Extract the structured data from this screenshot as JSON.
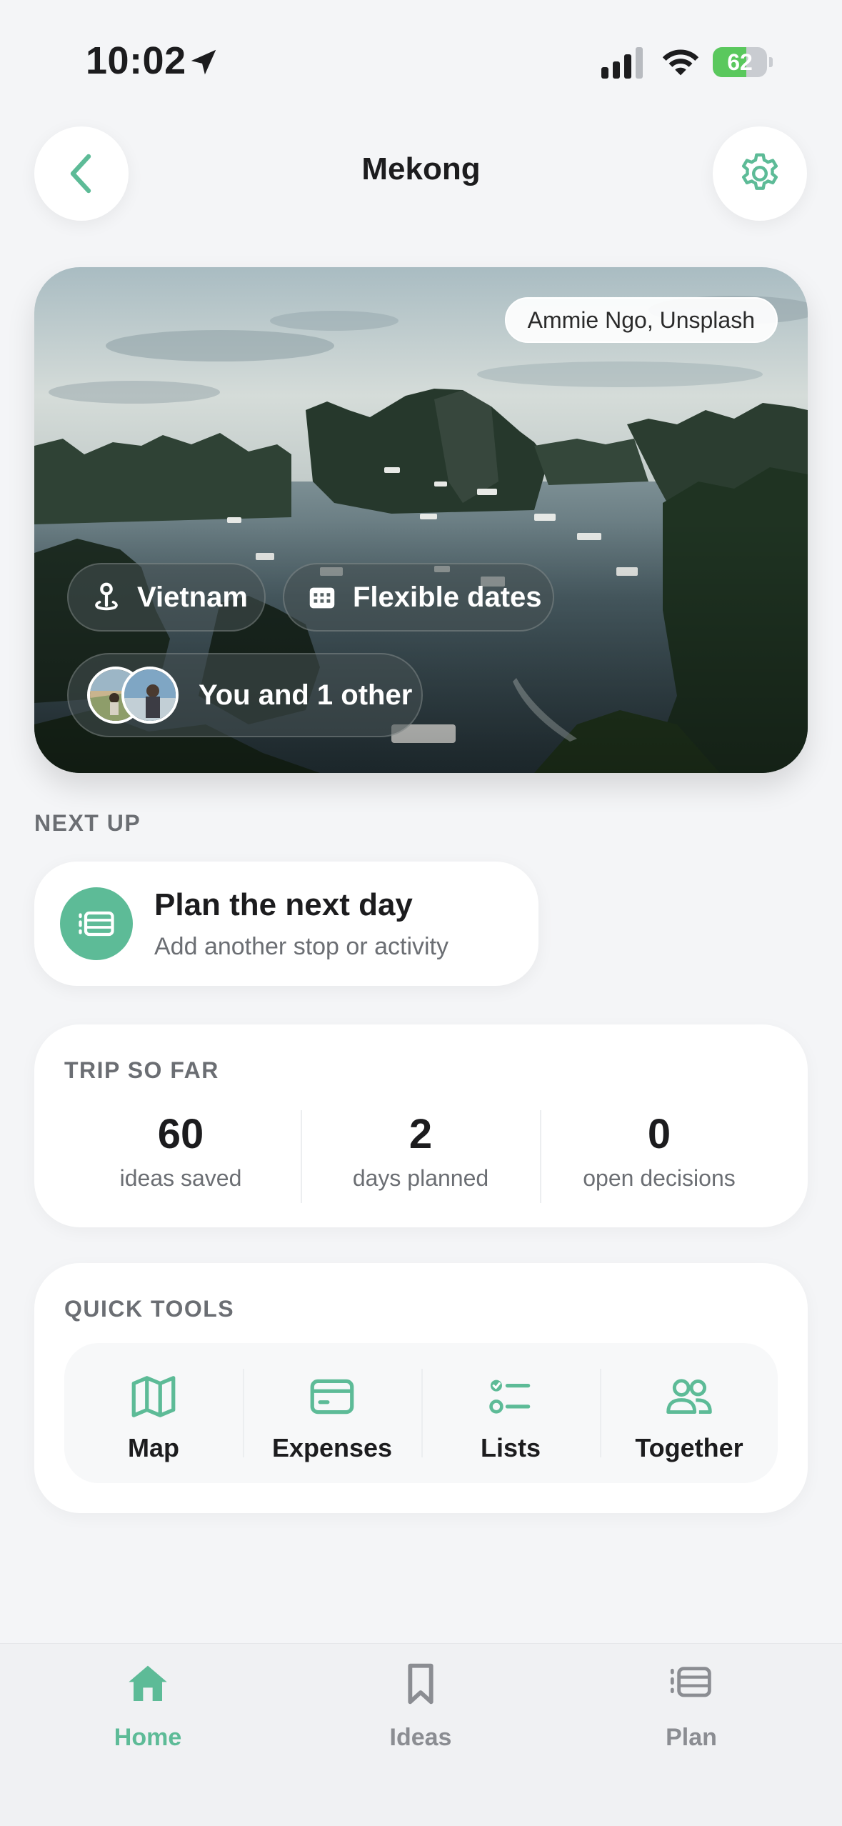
{
  "status_bar": {
    "time": "10:02",
    "battery_percent": "62",
    "battery_level": 0.62,
    "icons": [
      "location-arrow-icon",
      "cellular-signal-icon",
      "wifi-icon",
      "battery-charging-icon"
    ]
  },
  "header": {
    "title": "Mekong",
    "back_icon": "chevron-left-icon",
    "settings_icon": "gear-icon"
  },
  "hero": {
    "photo_credit": "Ammie Ngo, Unsplash",
    "location": "Vietnam",
    "dates": "Flexible dates",
    "people": "You and 1 other",
    "location_icon": "map-pin-icon",
    "dates_icon": "calendar-icon"
  },
  "next_up": {
    "label": "NEXT UP",
    "title": "Plan the next day",
    "subtitle": "Add another stop or activity",
    "icon": "itinerary-icon"
  },
  "trip_so_far": {
    "label": "TRIP SO FAR",
    "stats": [
      {
        "value": "60",
        "caption": "ideas saved"
      },
      {
        "value": "2",
        "caption": "days planned"
      },
      {
        "value": "0",
        "caption": "open decisions"
      }
    ]
  },
  "quick_tools": {
    "label": "QUICK TOOLS",
    "tools": [
      {
        "label": "Map",
        "icon": "map-icon"
      },
      {
        "label": "Expenses",
        "icon": "credit-card-icon"
      },
      {
        "label": "Lists",
        "icon": "checklist-icon"
      },
      {
        "label": "Together",
        "icon": "people-icon"
      }
    ]
  },
  "tab_bar": {
    "tabs": [
      {
        "label": "Home",
        "icon": "home-icon",
        "active": true
      },
      {
        "label": "Ideas",
        "icon": "bookmark-icon",
        "active": false
      },
      {
        "label": "Plan",
        "icon": "plan-icon",
        "active": false
      }
    ]
  },
  "colors": {
    "accent": "#5dbb97",
    "background": "#f4f5f7",
    "card": "#ffffff",
    "text_primary": "#1c1c1e",
    "text_secondary": "#6b6e73",
    "battery_green": "#5ac85d"
  }
}
